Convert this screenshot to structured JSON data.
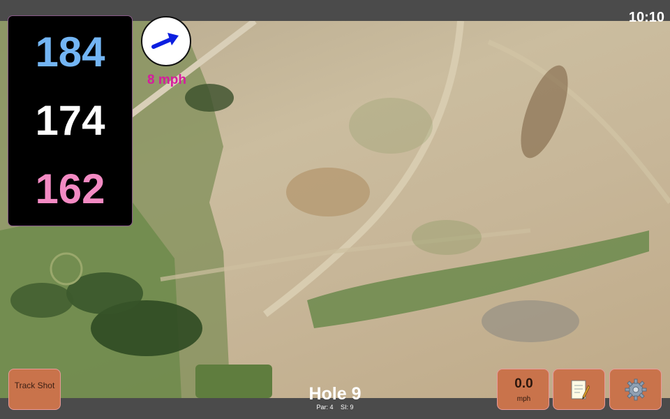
{
  "status": {
    "time": "10:10"
  },
  "distances": {
    "back": "184",
    "middle": "174",
    "front": "162"
  },
  "wind": {
    "speed": "8 mph",
    "arrow_color": "#0c1fe0",
    "icon": "wind-arrow-icon"
  },
  "hole": {
    "title": "Hole 9",
    "par": "Par: 4",
    "si": "SI: 9"
  },
  "buttons": {
    "track_shot": "Track Shot",
    "speed_value": "0.0",
    "speed_unit": "mph",
    "notes_icon": "notepad-icon",
    "settings_icon": "gear-icon"
  },
  "colors": {
    "panel_bg": "#000000",
    "back_color": "#73b5f4",
    "middle_color": "#ffffff",
    "front_color": "#f38ac3",
    "button_bg": "#c9734b",
    "wind_text": "#d71b9e"
  }
}
